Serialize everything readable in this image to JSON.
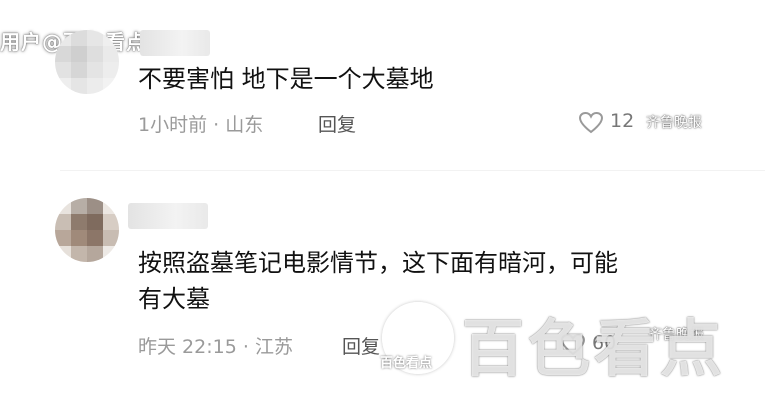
{
  "watermark": {
    "top_left": "用户@百色看点",
    "logo_small": "百色看点",
    "big": "百色看点",
    "qilu": "齐鲁晚报"
  },
  "comments": [
    {
      "text_lines": [
        "不要害怕  地下是一个大墓地"
      ],
      "time": "1小时前",
      "separator": "·",
      "location": "山东",
      "reply_label": "回复",
      "likes": "12"
    },
    {
      "text_lines": [
        "按照盗墓笔记电影情节，这下面有暗河，可能",
        "有大墓"
      ],
      "time": "昨天 22:15",
      "separator": "·",
      "location": "江苏",
      "reply_label": "回复",
      "likes": "60"
    }
  ],
  "icons": {
    "like": "heart-outline-icon",
    "logo": "baise-kandian-logo-icon"
  },
  "colors": {
    "comment_text": "#111111",
    "meta_text": "#9a9a9a",
    "reply_text": "#555555",
    "heart": "#9a9a9a"
  }
}
